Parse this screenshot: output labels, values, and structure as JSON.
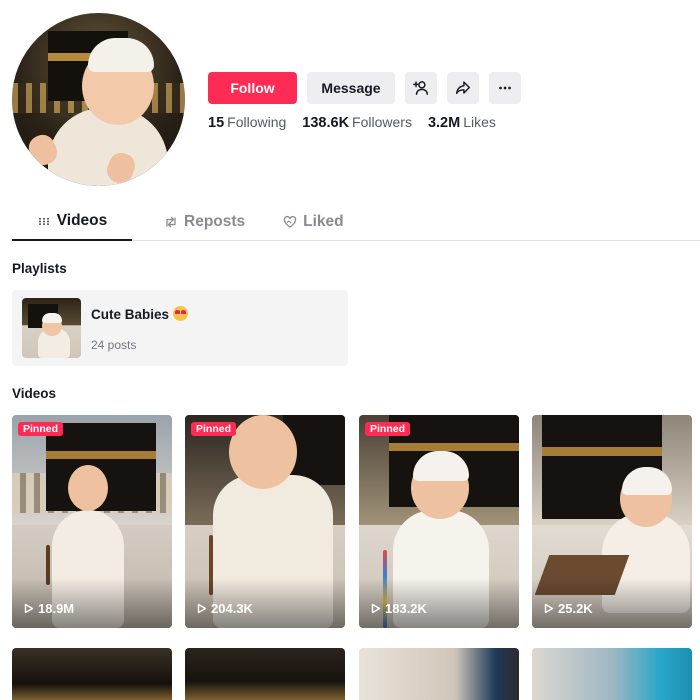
{
  "profile": {
    "buttons": {
      "follow": "Follow",
      "message": "Message",
      "add_friend_icon": "add-person-icon",
      "share_icon": "share-icon",
      "more_icon": "more-icon"
    },
    "stats": [
      {
        "value": "15",
        "label": "Following"
      },
      {
        "value": "138.6K",
        "label": "Followers"
      },
      {
        "value": "3.2M",
        "label": "Likes"
      }
    ]
  },
  "tabs": [
    {
      "label": "Videos",
      "icon": "grid-icon",
      "active": true
    },
    {
      "label": "Reposts",
      "icon": "repost-icon",
      "active": false
    },
    {
      "label": "Liked",
      "icon": "heart-icon",
      "active": false
    }
  ],
  "playlists": {
    "title": "Playlists",
    "items": [
      {
        "name": "Cute Babies",
        "count": "24 posts"
      }
    ]
  },
  "videos": {
    "title": "Videos",
    "items": [
      {
        "views": "18.9M",
        "badge": "Pinned"
      },
      {
        "views": "204.3K",
        "badge": "Pinned"
      },
      {
        "views": "183.2K",
        "badge": "Pinned"
      },
      {
        "views": "25.2K",
        "badge": ""
      }
    ]
  },
  "colors": {
    "accent": "#fe2c55",
    "text": "#161823",
    "muted": "#8a8b91",
    "button_bg": "#eeeef0"
  }
}
